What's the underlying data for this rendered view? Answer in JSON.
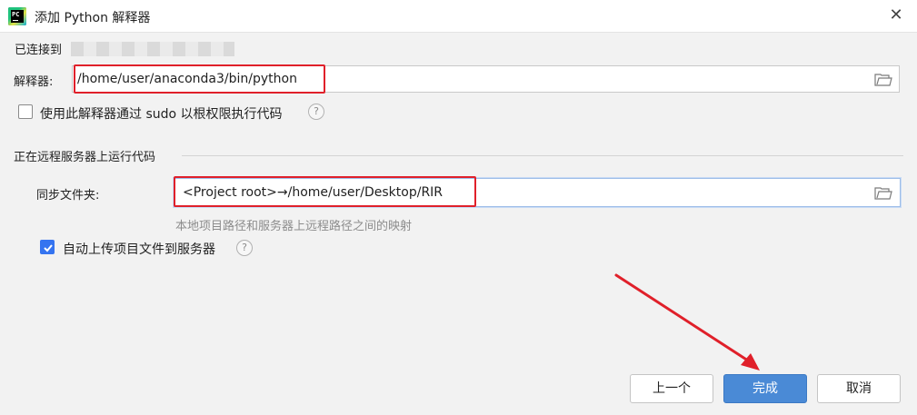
{
  "window": {
    "title": "添加 Python 解释器",
    "icon_name": "pycharm-icon",
    "close_glyph": "✕"
  },
  "connection": {
    "label": "已连接到"
  },
  "interpreter": {
    "label": "解释器:",
    "value": "/home/user/anaconda3/bin/python"
  },
  "sudo_option": {
    "label": "使用此解释器通过 sudo 以根权限执行代码",
    "checked": false
  },
  "remote_section": {
    "title": "正在远程服务器上运行代码",
    "sync_label": "同步文件夹:",
    "sync_value": "<Project root>→/home/user/Desktop/RIR",
    "sync_hint": "本地项目路径和服务器上远程路径之间的映射"
  },
  "auto_upload": {
    "label": "自动上传项目文件到服务器",
    "checked": true
  },
  "help_glyph": "?",
  "buttons": {
    "prev": "上一个",
    "finish": "完成",
    "cancel": "取消"
  },
  "colors": {
    "accent": "#4a8ad6",
    "highlight_box": "#e0202a",
    "checkbox_checked": "#3574f0"
  }
}
